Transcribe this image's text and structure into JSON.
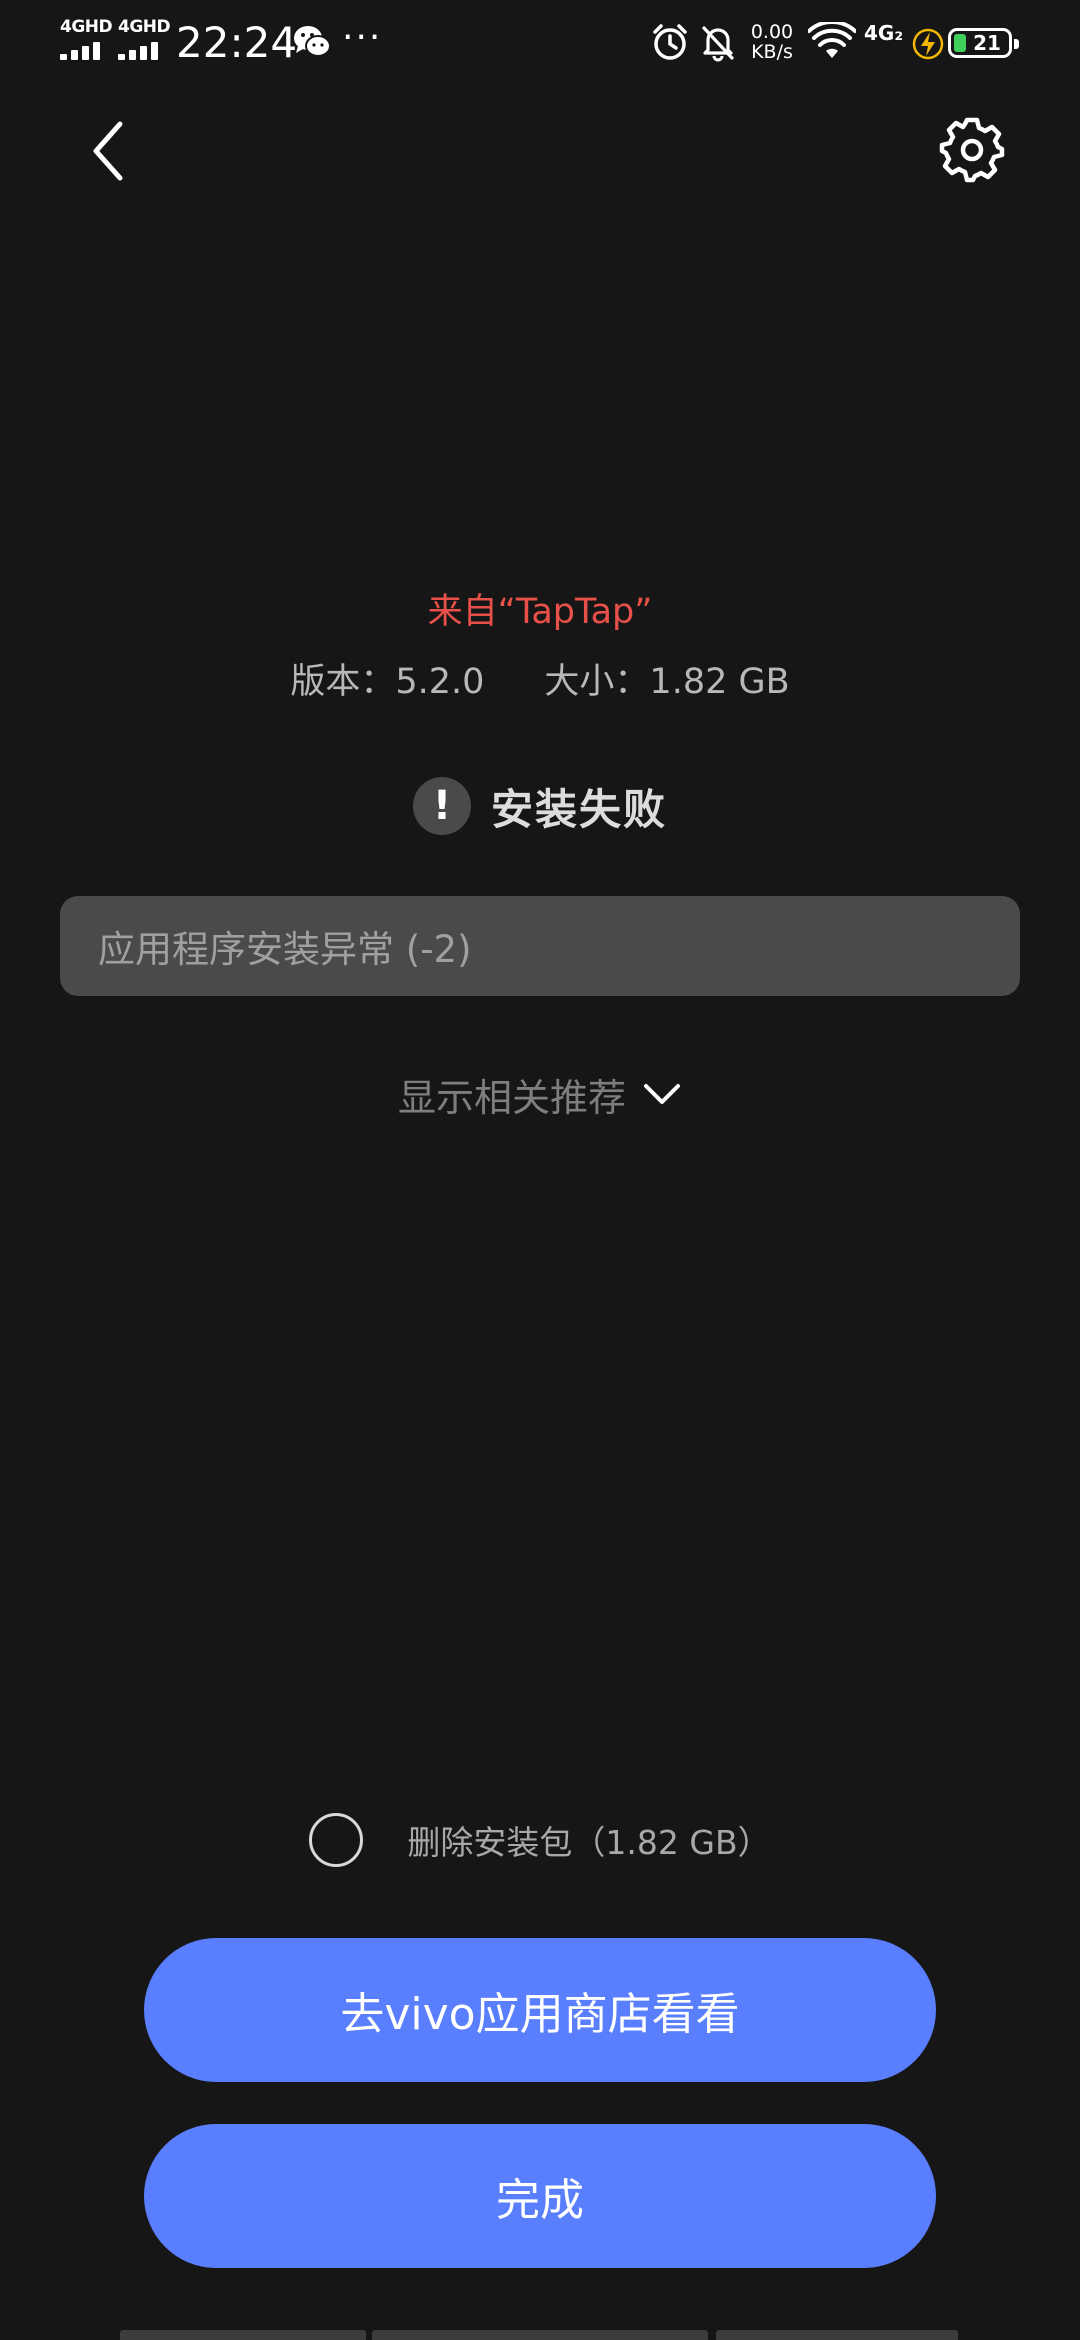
{
  "status_bar": {
    "sim1_network": "4GHD",
    "sim2_network": "4GHD",
    "time": "22:24",
    "more": "···",
    "net_speed_value": "0.00",
    "net_speed_unit": "KB/s",
    "data_network": "4G₂",
    "battery_level": "21",
    "battery_color": "#3ecf5c",
    "icons": [
      "wechat-icon",
      "alarm-icon",
      "mute-bell-icon",
      "wifi-icon",
      "charging-icon",
      "battery-icon"
    ]
  },
  "top_bar": {
    "back_icon": "back-chevron-icon",
    "settings_icon": "gear-icon"
  },
  "app_info": {
    "source": "来自“TapTap”",
    "version": "版本：5.2.0",
    "size": "大小：1.82 GB"
  },
  "result": {
    "status_icon": "exclamation-icon",
    "status_mark": "!",
    "title": "安装失败",
    "error_message": "应用程序安装异常 (-2)"
  },
  "recommend": {
    "label": "显示相关推荐",
    "icon": "chevron-down-icon"
  },
  "delete_option": {
    "label": "删除安装包（1.82 GB）",
    "checked": false
  },
  "buttons": {
    "store": "去vivo应用商店看看",
    "done": "完成"
  },
  "colors": {
    "background": "#161617",
    "accent_button": "#5a7ffe",
    "source_red": "#e8514a",
    "panel": "#4a4a4c"
  }
}
